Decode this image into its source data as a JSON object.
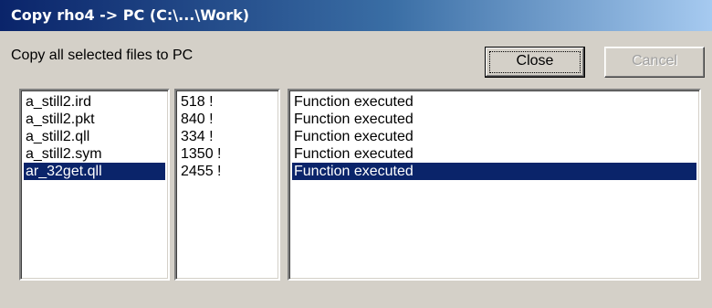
{
  "window": {
    "title": "Copy rho4 -> PC (C:\\...\\Work)"
  },
  "dialog": {
    "caption": "Copy all selected files to PC",
    "close_label": "Close",
    "cancel_label": "Cancel"
  },
  "files": [
    {
      "name": "a_still2.ird",
      "size": "518 !",
      "status": "Function executed",
      "selected": false
    },
    {
      "name": "a_still2.pkt",
      "size": "840 !",
      "status": "Function executed",
      "selected": false
    },
    {
      "name": "a_still2.qll",
      "size": "334 !",
      "status": "Function executed",
      "selected": false
    },
    {
      "name": "a_still2.sym",
      "size": "1350 !",
      "status": "Function executed",
      "selected": false
    },
    {
      "name": "ar_32get.qll",
      "size": "2455 !",
      "status": "Function executed",
      "selected": true
    }
  ],
  "colors": {
    "title_bar_start": "#0a246a",
    "title_bar_end": "#a6caf0",
    "dialog_face": "#d4d0c8",
    "selection": "#0a246a"
  }
}
